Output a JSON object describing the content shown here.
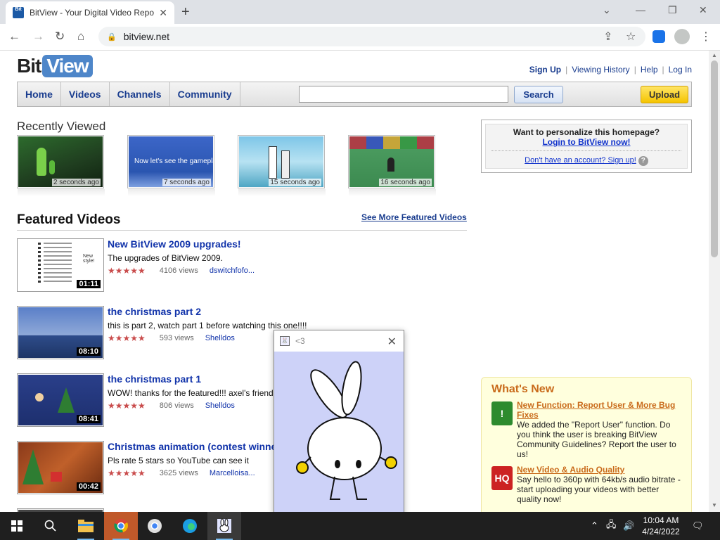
{
  "browser": {
    "tab_title": "BitView - Your Digital Video Repo",
    "favicon_text": "Bit",
    "url": "bitview.net"
  },
  "site": {
    "logo_bit": "Bit",
    "logo_view": "View",
    "top_links": {
      "signup": "Sign Up",
      "history": "Viewing History",
      "help": "Help",
      "login": "Log In"
    },
    "nav": [
      "Home",
      "Videos",
      "Channels",
      "Community"
    ],
    "search": {
      "value": "",
      "button": "Search"
    },
    "upload": "Upload"
  },
  "recently_viewed": {
    "heading": "Recently Viewed",
    "items": [
      {
        "ago": "2 seconds ago"
      },
      {
        "ago": "7 seconds ago",
        "overlay": "Now let's see the gameplay"
      },
      {
        "ago": "15 seconds ago"
      },
      {
        "ago": "16 seconds ago"
      }
    ]
  },
  "promo": {
    "question": "Want to personalize this homepage?",
    "login": "Login to BitView now!",
    "signup": "Don't have an account? Sign up!",
    "help": "?"
  },
  "featured": {
    "heading": "Featured Videos",
    "see_more": "See More Featured Videos",
    "videos": [
      {
        "title": "New BitView 2009 upgrades!",
        "desc": "The upgrades of BitView 2009.",
        "rating": 4.5,
        "views": "4106 views",
        "user": "dswitchfofo...",
        "duration": "01:11"
      },
      {
        "title": "the christmas part 2",
        "desc": "this is part 2, watch part 1 before watching this one!!!!",
        "rating": 4.5,
        "views": "593 views",
        "user": "Shelldos",
        "duration": "08:10"
      },
      {
        "title": "the christmas part 1",
        "desc": "WOW! thanks for the featured!!! axel's friend ... town fo...",
        "rating": 4.5,
        "views": "806 views",
        "user": "Shelldos",
        "duration": "08:41"
      },
      {
        "title": "Christmas animation (contest winne",
        "desc": "Pls rate 5 stars so YouTube can see it",
        "rating": 4.5,
        "views": "3625 views",
        "user": "Marcelloisa...",
        "duration": "00:42"
      }
    ]
  },
  "whats_new": {
    "heading": "What's New",
    "items": [
      {
        "title": "New Function: Report User & More Bug Fixes",
        "text": "We added the \"Report User\" function. Do you think the user is breaking BitView Community Guidelines? Report the user to us!",
        "icon": "!"
      },
      {
        "title": "New Video & Audio Quality",
        "text": "Say hello to 360p with 64kb/s audio bitrate - start uploading your videos with better quality now!",
        "icon": "HQ"
      }
    ]
  },
  "popup": {
    "title": "<3"
  },
  "taskbar": {
    "time": "10:04 AM",
    "date": "4/24/2022"
  },
  "colors": {
    "link": "#1a3d8f",
    "accent_orange": "#c96a1a",
    "upload_yellow": "#f5c400",
    "popup_bg": "#cdd2f8"
  }
}
